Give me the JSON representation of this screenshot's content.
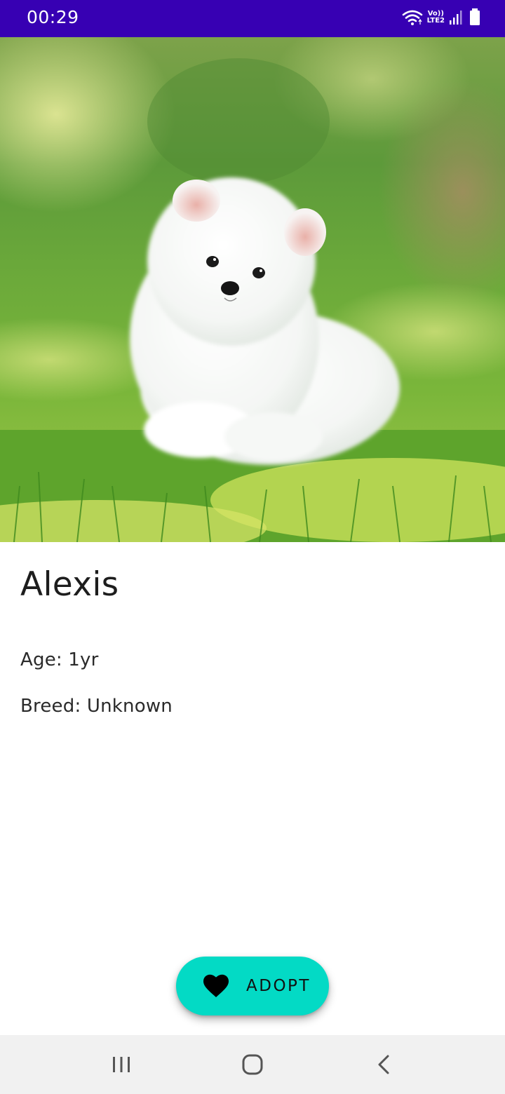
{
  "status_bar": {
    "time": "00:29",
    "network_top": "Vo))",
    "network_bottom": "LTE2",
    "icons": [
      "wifi-icon",
      "lte-icon",
      "signal-icon",
      "battery-icon"
    ],
    "background_color": "#3700b3"
  },
  "hero": {
    "image_description_icon": "puppy-photo"
  },
  "pet": {
    "name": "Alexis",
    "age": "Age: 1yr",
    "breed": "Breed: Unknown"
  },
  "adopt_button": {
    "label": "ADOPT",
    "icon": "heart-icon",
    "color": "#03dac5"
  },
  "nav_bar": {
    "icons": [
      "recent-apps-icon",
      "home-icon",
      "back-icon"
    ]
  }
}
